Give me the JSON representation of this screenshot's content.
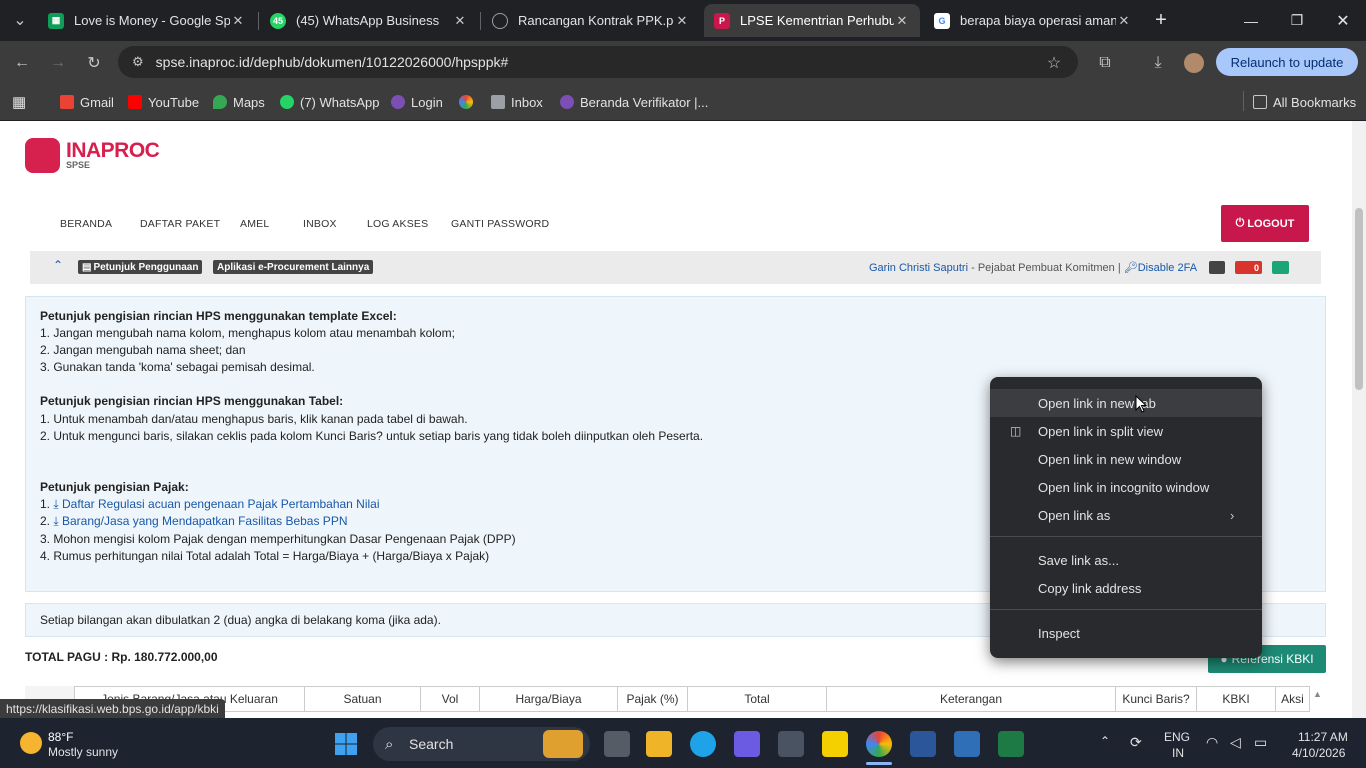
{
  "browser": {
    "tabs": [
      {
        "title": "Love is Money - Google Spre",
        "favicon_color": "#0f9d58",
        "icon": "sheets-icon"
      },
      {
        "title": "(45) WhatsApp Business",
        "favicon_color": "#25d366",
        "icon": "whatsapp-icon",
        "badge": "45"
      },
      {
        "title": "Rancangan Kontrak PPK.pdf",
        "favicon_color": "#9aa0a6",
        "icon": "globe-icon"
      },
      {
        "title": "LPSE Kementrian Perhubung",
        "favicon_color": "#c8174a",
        "icon": "lpse-icon"
      },
      {
        "title": "berapa biaya operasi amand",
        "favicon_color": "#4285f4",
        "icon": "google-icon"
      }
    ],
    "url": "spse.inaproc.id/dephub/dokumen/10122026000/hpsppk#",
    "relaunch_label": "Relaunch to update",
    "bookmarks": [
      {
        "label": "Gmail",
        "color": "#ea4335"
      },
      {
        "label": "YouTube",
        "color": "#ff0000"
      },
      {
        "label": "Maps",
        "color": "#34a853"
      },
      {
        "label": "(7) WhatsApp",
        "color": "#25d366"
      },
      {
        "label": "Login",
        "color": "#7b4fb3"
      },
      {
        "label": "",
        "color": "#fbbc05"
      },
      {
        "label": "Inbox",
        "color": "#9aa0a6"
      },
      {
        "label": "Beranda Verifikator |...",
        "color": "#7b4fb3"
      }
    ],
    "all_bookmarks": "All Bookmarks",
    "status_url": "https://klasifikasi.web.bps.go.id/app/kbki"
  },
  "site": {
    "logo_main": "INAPROC",
    "logo_sub": "SPSE",
    "nav": [
      "BERANDA",
      "DAFTAR PAKET",
      "AMEL",
      "INBOX",
      "LOG AKSES",
      "GANTI PASSWORD"
    ],
    "logout": "LOGOUT",
    "badges": [
      "Petunjuk Penggunaan",
      "Aplikasi e-Procurement Lainnya"
    ],
    "user_name": "Garin Christi Saputri",
    "user_role": " - Pejabat Pembuat Komitmen | ",
    "disable_2fa": "Disable 2FA",
    "mail_count": "0"
  },
  "panel": {
    "excel_title": "Petunjuk pengisian rincian HPS menggunakan template Excel:",
    "excel_items": [
      "1. Jangan mengubah nama kolom, menghapus kolom atau menambah kolom;",
      "2. Jangan mengubah nama sheet; dan",
      "3. Gunakan tanda 'koma' sebagai pemisah desimal."
    ],
    "table_title": "Petunjuk pengisian rincian HPS menggunakan Tabel:",
    "table_items": [
      "1. Untuk menambah dan/atau menghapus baris, klik kanan pada tabel di bawah.",
      "2. Untuk mengunci baris, silakan ceklis pada kolom Kunci Baris? untuk setiap baris yang tidak boleh diinputkan oleh Peserta."
    ],
    "tax_title": "Petunjuk pengisian Pajak:",
    "tax_link1_num": "1. ",
    "tax_link1": "Daftar Regulasi acuan pengenaan Pajak Pertambahan Nilai",
    "tax_link2_num": "2. ",
    "tax_link2": "Barang/Jasa yang Mendapatkan Fasilitas Bebas PPN",
    "tax_items": [
      "3. Mohon mengisi kolom Pajak dengan memperhitungkan Dasar Pengenaan Pajak (DPP)",
      "4. Rumus perhitungan nilai Total adalah Total = Harga/Biaya + (Harga/Biaya x Pajak)"
    ]
  },
  "notice": "Setiap bilangan akan dibulatkan 2 (dua) angka di belakang koma (jika ada).",
  "total_pagu": "TOTAL PAGU : Rp. 180.772.000,00",
  "kbki_button": "Referensi KBKI",
  "table_headers": [
    "Jenis Barang/Jasa atau Keluaran",
    "Satuan",
    "Vol",
    "Harga/Biaya",
    "Pajak (%)",
    "Total",
    "Keterangan",
    "Kunci Baris?",
    "KBKI",
    "Aksi"
  ],
  "context_menu": {
    "items": [
      "Open link in new tab",
      "Open link in split view",
      "Open link in new window",
      "Open link in incognito window",
      "Open link as",
      "Save link as...",
      "Copy link address",
      "Inspect"
    ]
  },
  "taskbar": {
    "weather_temp": "88°F",
    "weather_desc": "Mostly sunny",
    "search_placeholder": "Search",
    "lang1": "ENG",
    "lang2": "IN",
    "time": "11:27 AM",
    "date": "4/10/2026"
  }
}
